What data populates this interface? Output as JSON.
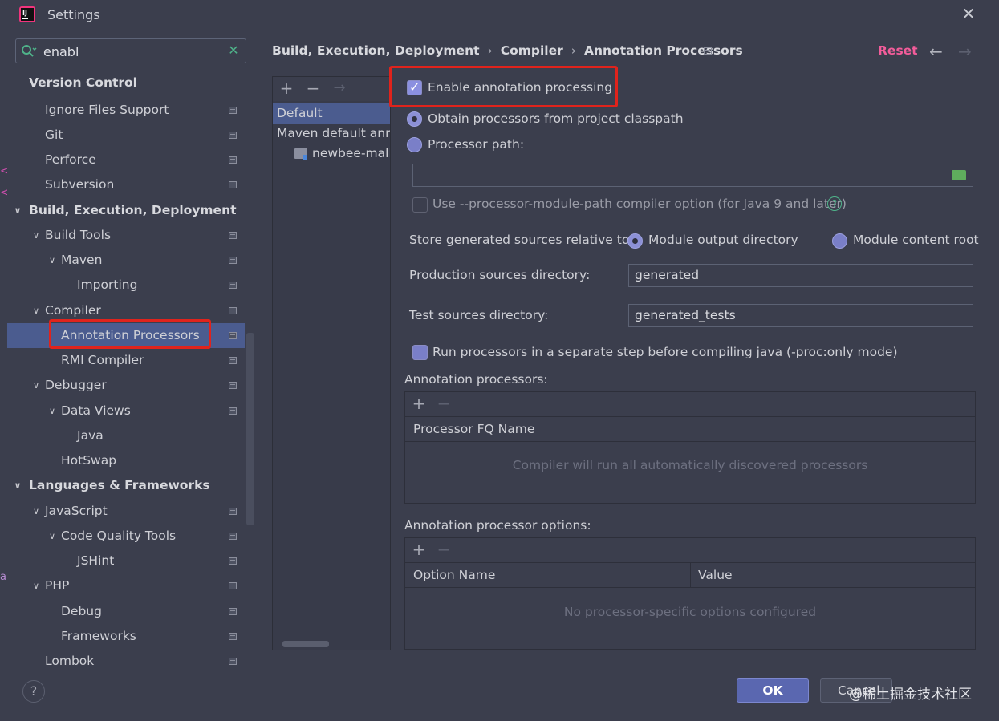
{
  "window": {
    "title": "Settings"
  },
  "search": {
    "value": "enabl"
  },
  "tree": [
    {
      "label": "Version Control",
      "bold": true
    },
    {
      "label": "Ignore Files Support"
    },
    {
      "label": "Git"
    },
    {
      "label": "Perforce"
    },
    {
      "label": "Subversion"
    },
    {
      "label": "Build, Execution, Deployment",
      "bold": true
    },
    {
      "label": "Build Tools"
    },
    {
      "label": "Maven"
    },
    {
      "label": "Importing"
    },
    {
      "label": "Compiler"
    },
    {
      "label": "Annotation Processors",
      "selected": true
    },
    {
      "label": "RMI Compiler"
    },
    {
      "label": "Debugger"
    },
    {
      "label": "Data Views"
    },
    {
      "label": "Java"
    },
    {
      "label": "HotSwap"
    },
    {
      "label": "Languages & Frameworks",
      "bold": true
    },
    {
      "label": "JavaScript"
    },
    {
      "label": "Code Quality Tools"
    },
    {
      "label": "JSHint"
    },
    {
      "label": "PHP"
    },
    {
      "label": "Debug"
    },
    {
      "label": "Frameworks"
    },
    {
      "label": "Lombok"
    }
  ],
  "breadcrumb": {
    "part1": "Build, Execution, Deployment",
    "part2": "Compiler",
    "part3": "Annotation Processors",
    "sep": "›"
  },
  "header": {
    "reset": "Reset"
  },
  "profiles": {
    "items": [
      {
        "label": "Default",
        "selected": true
      },
      {
        "label": "Maven default annotation processors profile"
      },
      {
        "label": "newbee-mall-plus"
      }
    ]
  },
  "form": {
    "enable_label": "Enable annotation processing",
    "enable_checked": true,
    "obtain_label": "Obtain processors from project classpath",
    "processor_path_label": "Processor path:",
    "processor_path_value": "",
    "module_path_label": "Use --processor-module-path compiler option (for Java 9 and later)",
    "store_label": "Store generated sources relative to:",
    "module_output_label": "Module output directory",
    "module_content_label": "Module content root",
    "production_label": "Production sources directory:",
    "production_value": "generated",
    "test_label": "Test sources directory:",
    "test_value": "generated_tests",
    "run_separate_label": "Run processors in a separate step before compiling java (-proc:only mode)",
    "processors_section": "Annotation processors:",
    "processors_column": "Processor FQ Name",
    "processors_empty": "Compiler will run all automatically discovered processors",
    "options_section": "Annotation processor options:",
    "options_col_name": "Option Name",
    "options_col_value": "Value",
    "options_empty": "No processor-specific options configured"
  },
  "footer": {
    "ok": "OK",
    "cancel": "Cancel",
    "help": "?",
    "watermark": "@稀土掘金技术社区"
  },
  "colors": {
    "accent": "#4b5c8f",
    "reset": "#f25c9a",
    "highlight": "#e0231c",
    "ok": "#5a67b0"
  },
  "icons": [
    "app-icon",
    "close-icon",
    "search-icon",
    "clear-icon",
    "project-scope-icon",
    "chevron-down-icon",
    "back-arrow-icon",
    "forward-arrow-icon",
    "add-icon",
    "remove-icon",
    "folder-icon",
    "help-icon"
  ]
}
